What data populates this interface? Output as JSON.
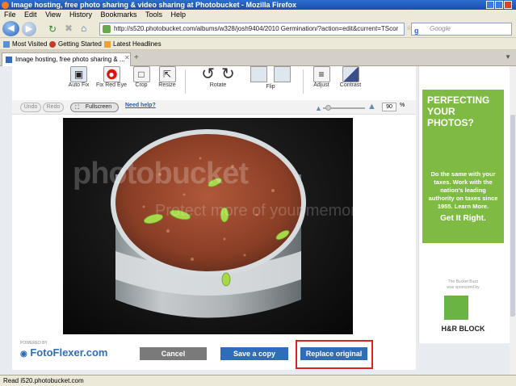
{
  "window": {
    "title": "Image hosting, free photo sharing & video sharing at Photobucket - Mozilla Firefox"
  },
  "menu": [
    "File",
    "Edit",
    "View",
    "History",
    "Bookmarks",
    "Tools",
    "Help"
  ],
  "nav": {
    "url": "http://s520.photobucket.com/albums/w328/josh9404/2010 Germination/?action=edit&current=TScor",
    "search_placeholder": "Google"
  },
  "bookmarks": [
    "Most Visited",
    "Getting Started",
    "Latest Headlines"
  ],
  "tab": {
    "label": "Image hosting, free photo sharing & ..."
  },
  "tools": [
    {
      "label": "Auto Fix"
    },
    {
      "label": "Fix Red Eye"
    },
    {
      "label": "Crop"
    },
    {
      "label": "Resize"
    },
    {
      "label": "Rotate"
    },
    {
      "label": "Flip"
    },
    {
      "label": "Adjust"
    },
    {
      "label": "Contrast"
    }
  ],
  "subtoolbar": {
    "undo": "Undo",
    "redo": "Redo",
    "fullscreen": "Fullscreen",
    "help": "Need help?",
    "zoom": "90",
    "zoom_unit": "%"
  },
  "watermark": {
    "line1": "protect more of your memories for less!",
    "brand": "photobucket",
    "line2": "Protect more of your memories for less."
  },
  "ad": {
    "headline": "PERFECTING YOUR PHOTOS?",
    "body": "Do the same with your taxes. Work with the nation's leading authority on taxes since 1955. Learn More.",
    "cta": "Get It Right.",
    "sponsor_line1": "The Bucket Buzz",
    "sponsor_line2": "was sponsored by",
    "brand": "H&R BLOCK"
  },
  "footer": {
    "powered_by": "POWERED BY",
    "fotoflexer": "FotoFlexer.com",
    "cancel": "Cancel",
    "save_copy": "Save a copy",
    "replace": "Replace original"
  },
  "status": {
    "text": "Read i520.photobucket.com"
  },
  "colors": {
    "accent_blue": "#2f6db8",
    "cancel_gray": "#7a7a7a",
    "highlight_red": "#e02020",
    "ad_green": "#7fbb42"
  }
}
